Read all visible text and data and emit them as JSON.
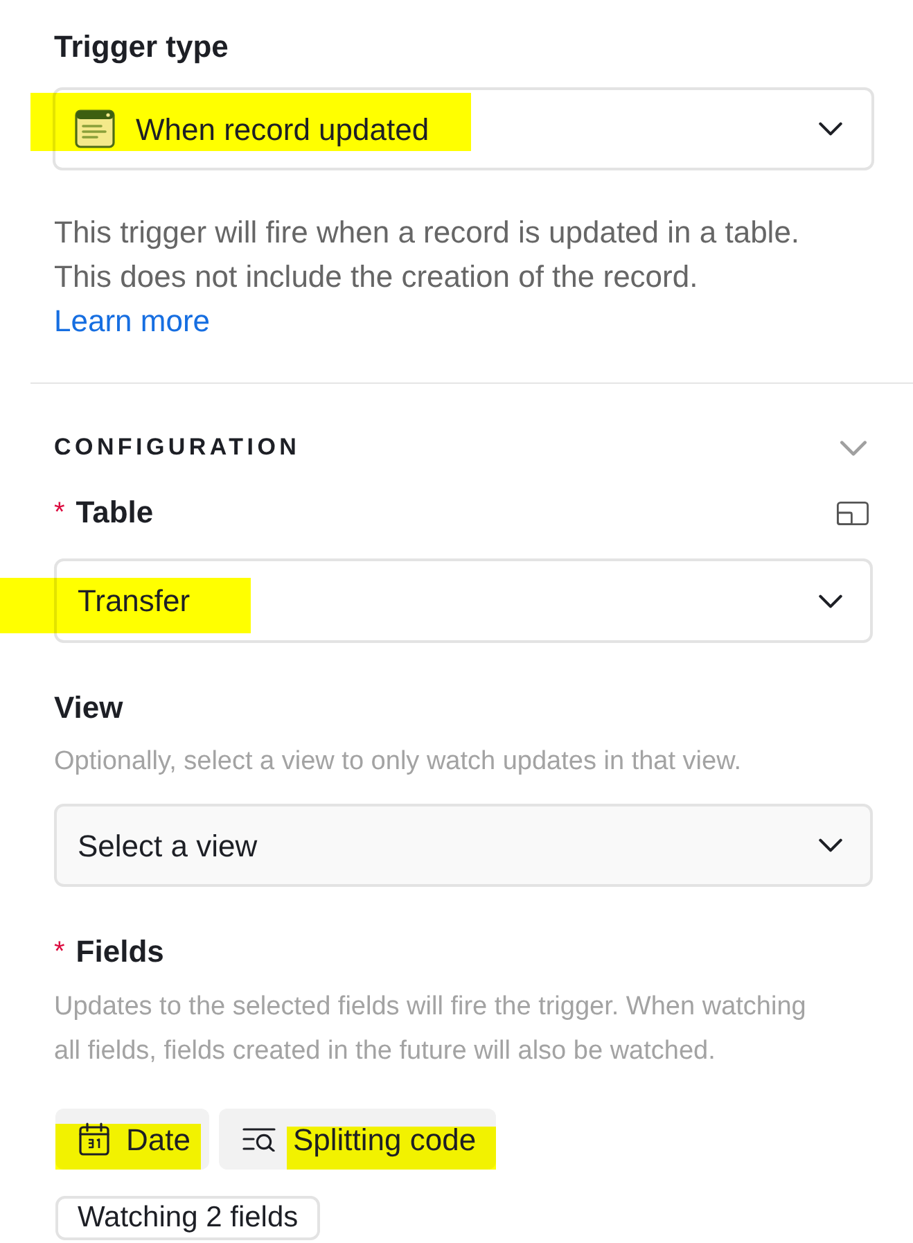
{
  "trigger_type": {
    "label": "Trigger type",
    "select": {
      "value": "When record updated",
      "highlighted": true
    },
    "description": "This trigger will fire when a record is updated in a table. This does not include the creation of the record.",
    "link": "Learn more"
  },
  "configuration": {
    "heading": "CONFIGURATION",
    "table": {
      "label": "Table",
      "required_mark": "*",
      "select": {
        "value": "Transfer",
        "highlighted": true
      }
    },
    "view": {
      "label": "View",
      "hint": "Optionally, select a view to only watch updates in that view.",
      "select": {
        "placeholder": "Select a view"
      }
    },
    "fields": {
      "label": "Fields",
      "required_mark": "*",
      "hint": "Updates to the selected fields will fire the trigger. When watching all fields, fields created in the future will also be watched.",
      "chips": [
        {
          "label": "Date",
          "kind": "date",
          "highlighted": true
        },
        {
          "label": "Splitting code",
          "kind": "text",
          "highlighted": true
        }
      ],
      "button": "Watching 2 fields"
    }
  }
}
